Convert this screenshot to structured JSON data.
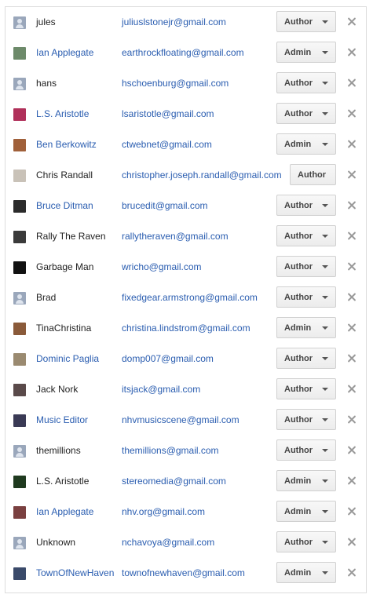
{
  "users": [
    {
      "name": "jules",
      "email": "juliuslstonejr@gmail.com",
      "role": "Author",
      "name_link": false,
      "avatar": "generic-user-avatar",
      "has_dropdown": true
    },
    {
      "name": "Ian Applegate",
      "email": "earthrockfloating@gmail.com",
      "role": "Admin",
      "name_link": true,
      "avatar": "photo-avatar",
      "avatar_color": "#6d8a6a",
      "has_dropdown": true
    },
    {
      "name": "hans",
      "email": "hschoenburg@gmail.com",
      "role": "Author",
      "name_link": false,
      "avatar": "generic-user-avatar",
      "has_dropdown": true
    },
    {
      "name": "L.S. Aristotle",
      "email": "lsaristotle@gmail.com",
      "role": "Author",
      "name_link": true,
      "avatar": "photo-avatar",
      "avatar_color": "#b0305a",
      "has_dropdown": true
    },
    {
      "name": "Ben Berkowitz",
      "email": "ctwebnet@gmail.com",
      "role": "Admin",
      "name_link": true,
      "avatar": "photo-avatar",
      "avatar_color": "#a0603a",
      "has_dropdown": true
    },
    {
      "name": "Chris Randall",
      "email": "christopher.joseph.randall@gmail.com",
      "role": "Author",
      "name_link": false,
      "avatar": "photo-avatar",
      "avatar_color": "#c9c2b8",
      "has_dropdown": false
    },
    {
      "name": "Bruce Ditman",
      "email": "brucedit@gmail.com",
      "role": "Author",
      "name_link": true,
      "avatar": "photo-avatar",
      "avatar_color": "#2b2b2b",
      "has_dropdown": true
    },
    {
      "name": "Rally The Raven",
      "email": "rallytheraven@gmail.com",
      "role": "Author",
      "name_link": false,
      "avatar": "photo-avatar",
      "avatar_color": "#3a3a3a",
      "has_dropdown": true
    },
    {
      "name": "Garbage Man",
      "email": "wricho@gmail.com",
      "role": "Author",
      "name_link": false,
      "avatar": "photo-avatar",
      "avatar_color": "#111111",
      "has_dropdown": true
    },
    {
      "name": "Brad",
      "email": "fixedgear.armstrong@gmail.com",
      "role": "Author",
      "name_link": false,
      "avatar": "generic-user-avatar",
      "has_dropdown": true
    },
    {
      "name": "TinaChristina",
      "email": "christina.lindstrom@gmail.com",
      "role": "Admin",
      "name_link": false,
      "avatar": "photo-avatar",
      "avatar_color": "#8a5a3a",
      "has_dropdown": true
    },
    {
      "name": "Dominic Paglia",
      "email": "domp007@gmail.com",
      "role": "Author",
      "name_link": true,
      "avatar": "photo-avatar",
      "avatar_color": "#9a8a70",
      "has_dropdown": true
    },
    {
      "name": "Jack Nork",
      "email": "itsjack@gmail.com",
      "role": "Author",
      "name_link": false,
      "avatar": "photo-avatar",
      "avatar_color": "#5a4a4a",
      "has_dropdown": true
    },
    {
      "name": "Music Editor",
      "email": "nhvmusicscene@gmail.com",
      "role": "Author",
      "name_link": true,
      "avatar": "photo-avatar",
      "avatar_color": "#3a3a55",
      "has_dropdown": true
    },
    {
      "name": "themillions",
      "email": "themillions@gmail.com",
      "role": "Author",
      "name_link": false,
      "avatar": "generic-user-avatar",
      "has_dropdown": true
    },
    {
      "name": "L.S. Aristotle",
      "email": "stereomedia@gmail.com",
      "role": "Admin",
      "name_link": false,
      "avatar": "photo-avatar",
      "avatar_color": "#1f3a1f",
      "has_dropdown": true
    },
    {
      "name": "Ian Applegate",
      "email": "nhv.org@gmail.com",
      "role": "Admin",
      "name_link": true,
      "avatar": "photo-avatar",
      "avatar_color": "#7a4040",
      "has_dropdown": true
    },
    {
      "name": "Unknown",
      "email": "nchavoya@gmail.com",
      "role": "Author",
      "name_link": false,
      "avatar": "generic-user-avatar",
      "has_dropdown": true
    },
    {
      "name": "TownOfNewHaven",
      "email": "townofnewhaven@gmail.com",
      "role": "Admin",
      "name_link": true,
      "avatar": "photo-avatar",
      "avatar_color": "#3a4a6a",
      "has_dropdown": true
    }
  ],
  "colors": {
    "link": "#2a5db0",
    "text": "#222222",
    "button_text": "#444444",
    "remove_icon": "#999999"
  },
  "icons": {
    "remove": "close-icon",
    "dropdown": "chevron-down-icon"
  }
}
